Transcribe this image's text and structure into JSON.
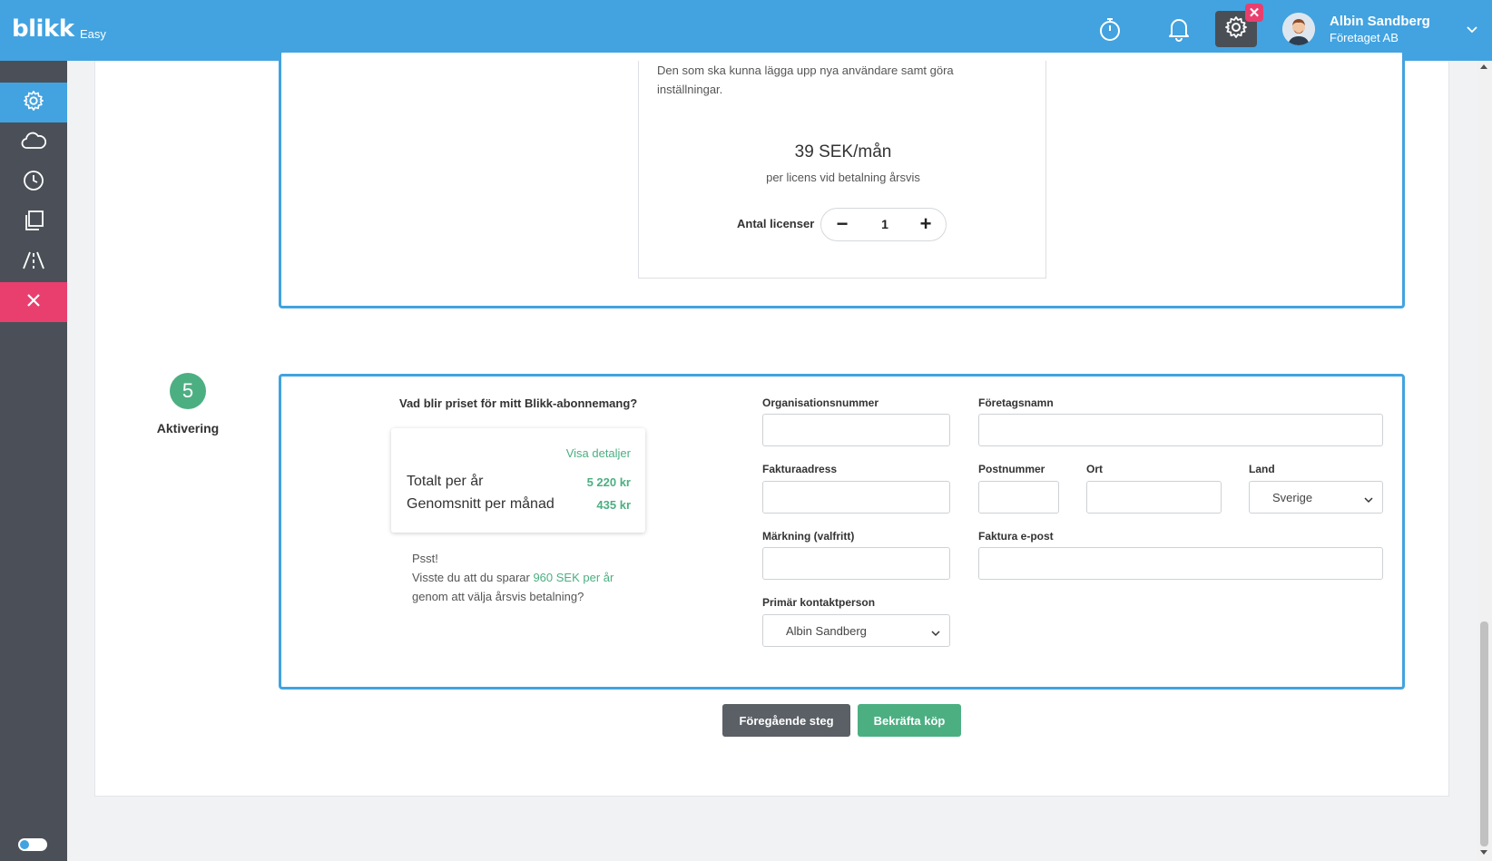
{
  "header": {
    "logo_text": "blikk",
    "logo_sub": "Easy",
    "icons": [
      "stopwatch-icon",
      "bell-icon",
      "gear-icon"
    ],
    "gear_badge": "✕",
    "user_name": "Albin Sandberg",
    "user_company": "Företaget AB"
  },
  "sidebar": {
    "items": [
      {
        "icon": "gear-icon",
        "active": true
      },
      {
        "icon": "cloud-icon"
      },
      {
        "icon": "clock-icon"
      },
      {
        "icon": "documents-icon"
      },
      {
        "icon": "road-icon"
      },
      {
        "icon": "close-icon",
        "close": true
      }
    ]
  },
  "license": {
    "description": "Den som ska kunna lägga upp nya användare samt göra inställningar.",
    "price": "39 SEK/mån",
    "price_note": "per licens vid betalning årsvis",
    "count_label": "Antal licenser",
    "count_value": "1",
    "minus": "−",
    "plus": "+"
  },
  "step": {
    "number": "5",
    "label": "Aktivering"
  },
  "pricing": {
    "question": "Vad blir priset för mitt Blikk-abonnemang?",
    "details_link": "Visa detaljer",
    "total_label": "Totalt per år",
    "total_value": "5 220 kr",
    "avg_label": "Genomsnitt per månad",
    "avg_value": "435 kr",
    "psst": "Psst!",
    "tip_before": "Visste du att du sparar ",
    "tip_highlight": "960 SEK per år",
    "tip_after": "genom att välja årsvis betalning?"
  },
  "form": {
    "org_number_label": "Organisationsnummer",
    "company_name_label": "Företagsnamn",
    "invoice_address_label": "Fakturaadress",
    "postal_code_label": "Postnummer",
    "city_label": "Ort",
    "country_label": "Land",
    "country_value": "Sverige",
    "marking_label": "Märkning (valfritt)",
    "invoice_email_label": "Faktura e-post",
    "contact_label": "Primär kontaktperson",
    "contact_value": "Albin Sandberg"
  },
  "actions": {
    "previous": "Föregående steg",
    "confirm": "Bekräfta köp"
  },
  "colors": {
    "primary": "#42a3e0",
    "success": "#4caf82",
    "danger": "#e93f6f",
    "sidebar": "#4b5058"
  }
}
